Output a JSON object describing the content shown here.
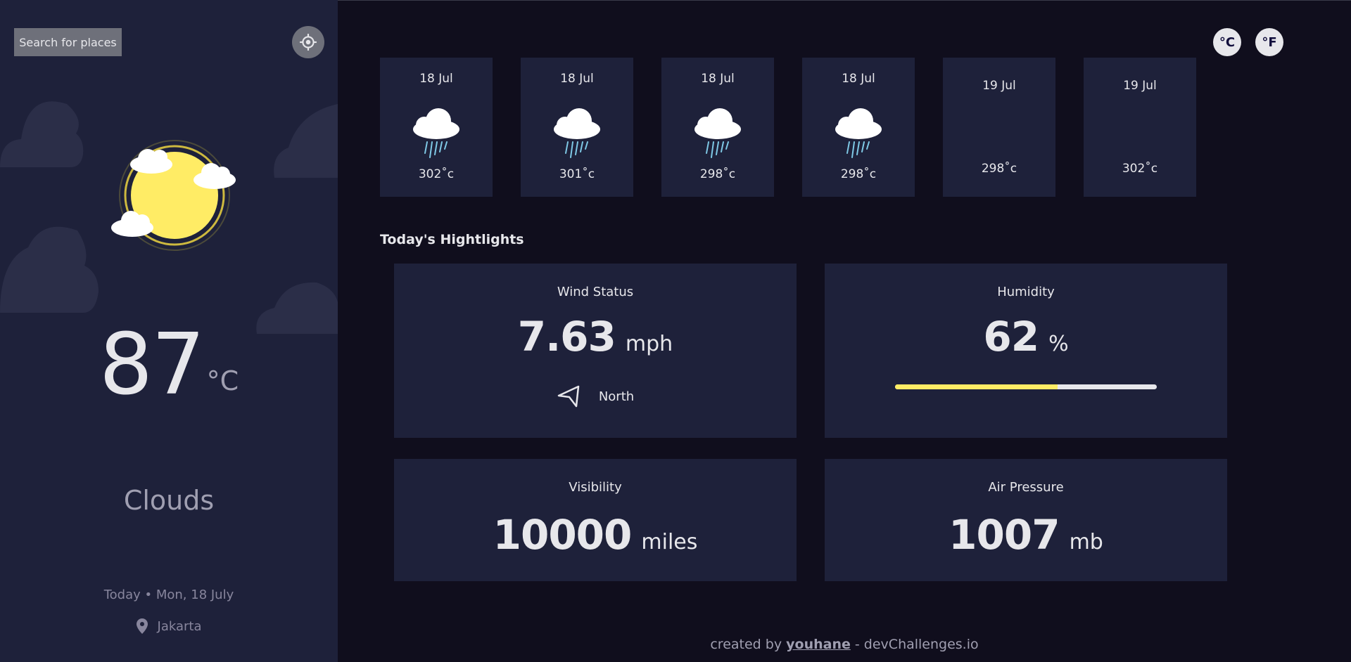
{
  "sidebar": {
    "search_label": "Search for places",
    "temperature": "87",
    "temperature_unit": "°C",
    "condition": "Clouds",
    "date": "Today • Mon, 18 July",
    "location": "Jakarta"
  },
  "units": {
    "celsius": "°C",
    "fahrenheit": "°F"
  },
  "forecast": [
    {
      "date": "18 Jul",
      "temp": "302˚c",
      "icon": "light-rain-icon"
    },
    {
      "date": "18 Jul",
      "temp": "301˚c",
      "icon": "light-rain-icon"
    },
    {
      "date": "18 Jul",
      "temp": "298˚c",
      "icon": "light-rain-icon"
    },
    {
      "date": "18 Jul",
      "temp": "298˚c",
      "icon": "light-rain-icon"
    },
    {
      "date": "19 Jul",
      "temp": "298˚c",
      "icon": ""
    },
    {
      "date": "19 Jul",
      "temp": "302˚c",
      "icon": ""
    }
  ],
  "highlights": {
    "title": "Today's Hightlights",
    "wind": {
      "label": "Wind Status",
      "value": "7.63",
      "unit": "mph",
      "direction": "North"
    },
    "humidity": {
      "label": "Humidity",
      "value": "62",
      "unit": "%",
      "percent": 62
    },
    "visibility": {
      "label": "Visibility",
      "value": "10000",
      "unit": "miles"
    },
    "pressure": {
      "label": "Air Pressure",
      "value": "1007",
      "unit": "mb"
    }
  },
  "footer": {
    "prefix": "created by",
    "author": "youhane",
    "suffix": "- devChallenges.io"
  },
  "colors": {
    "sidebar_bg": "#1e213a",
    "page_bg": "#100e1d",
    "accent": "#ffec65"
  }
}
